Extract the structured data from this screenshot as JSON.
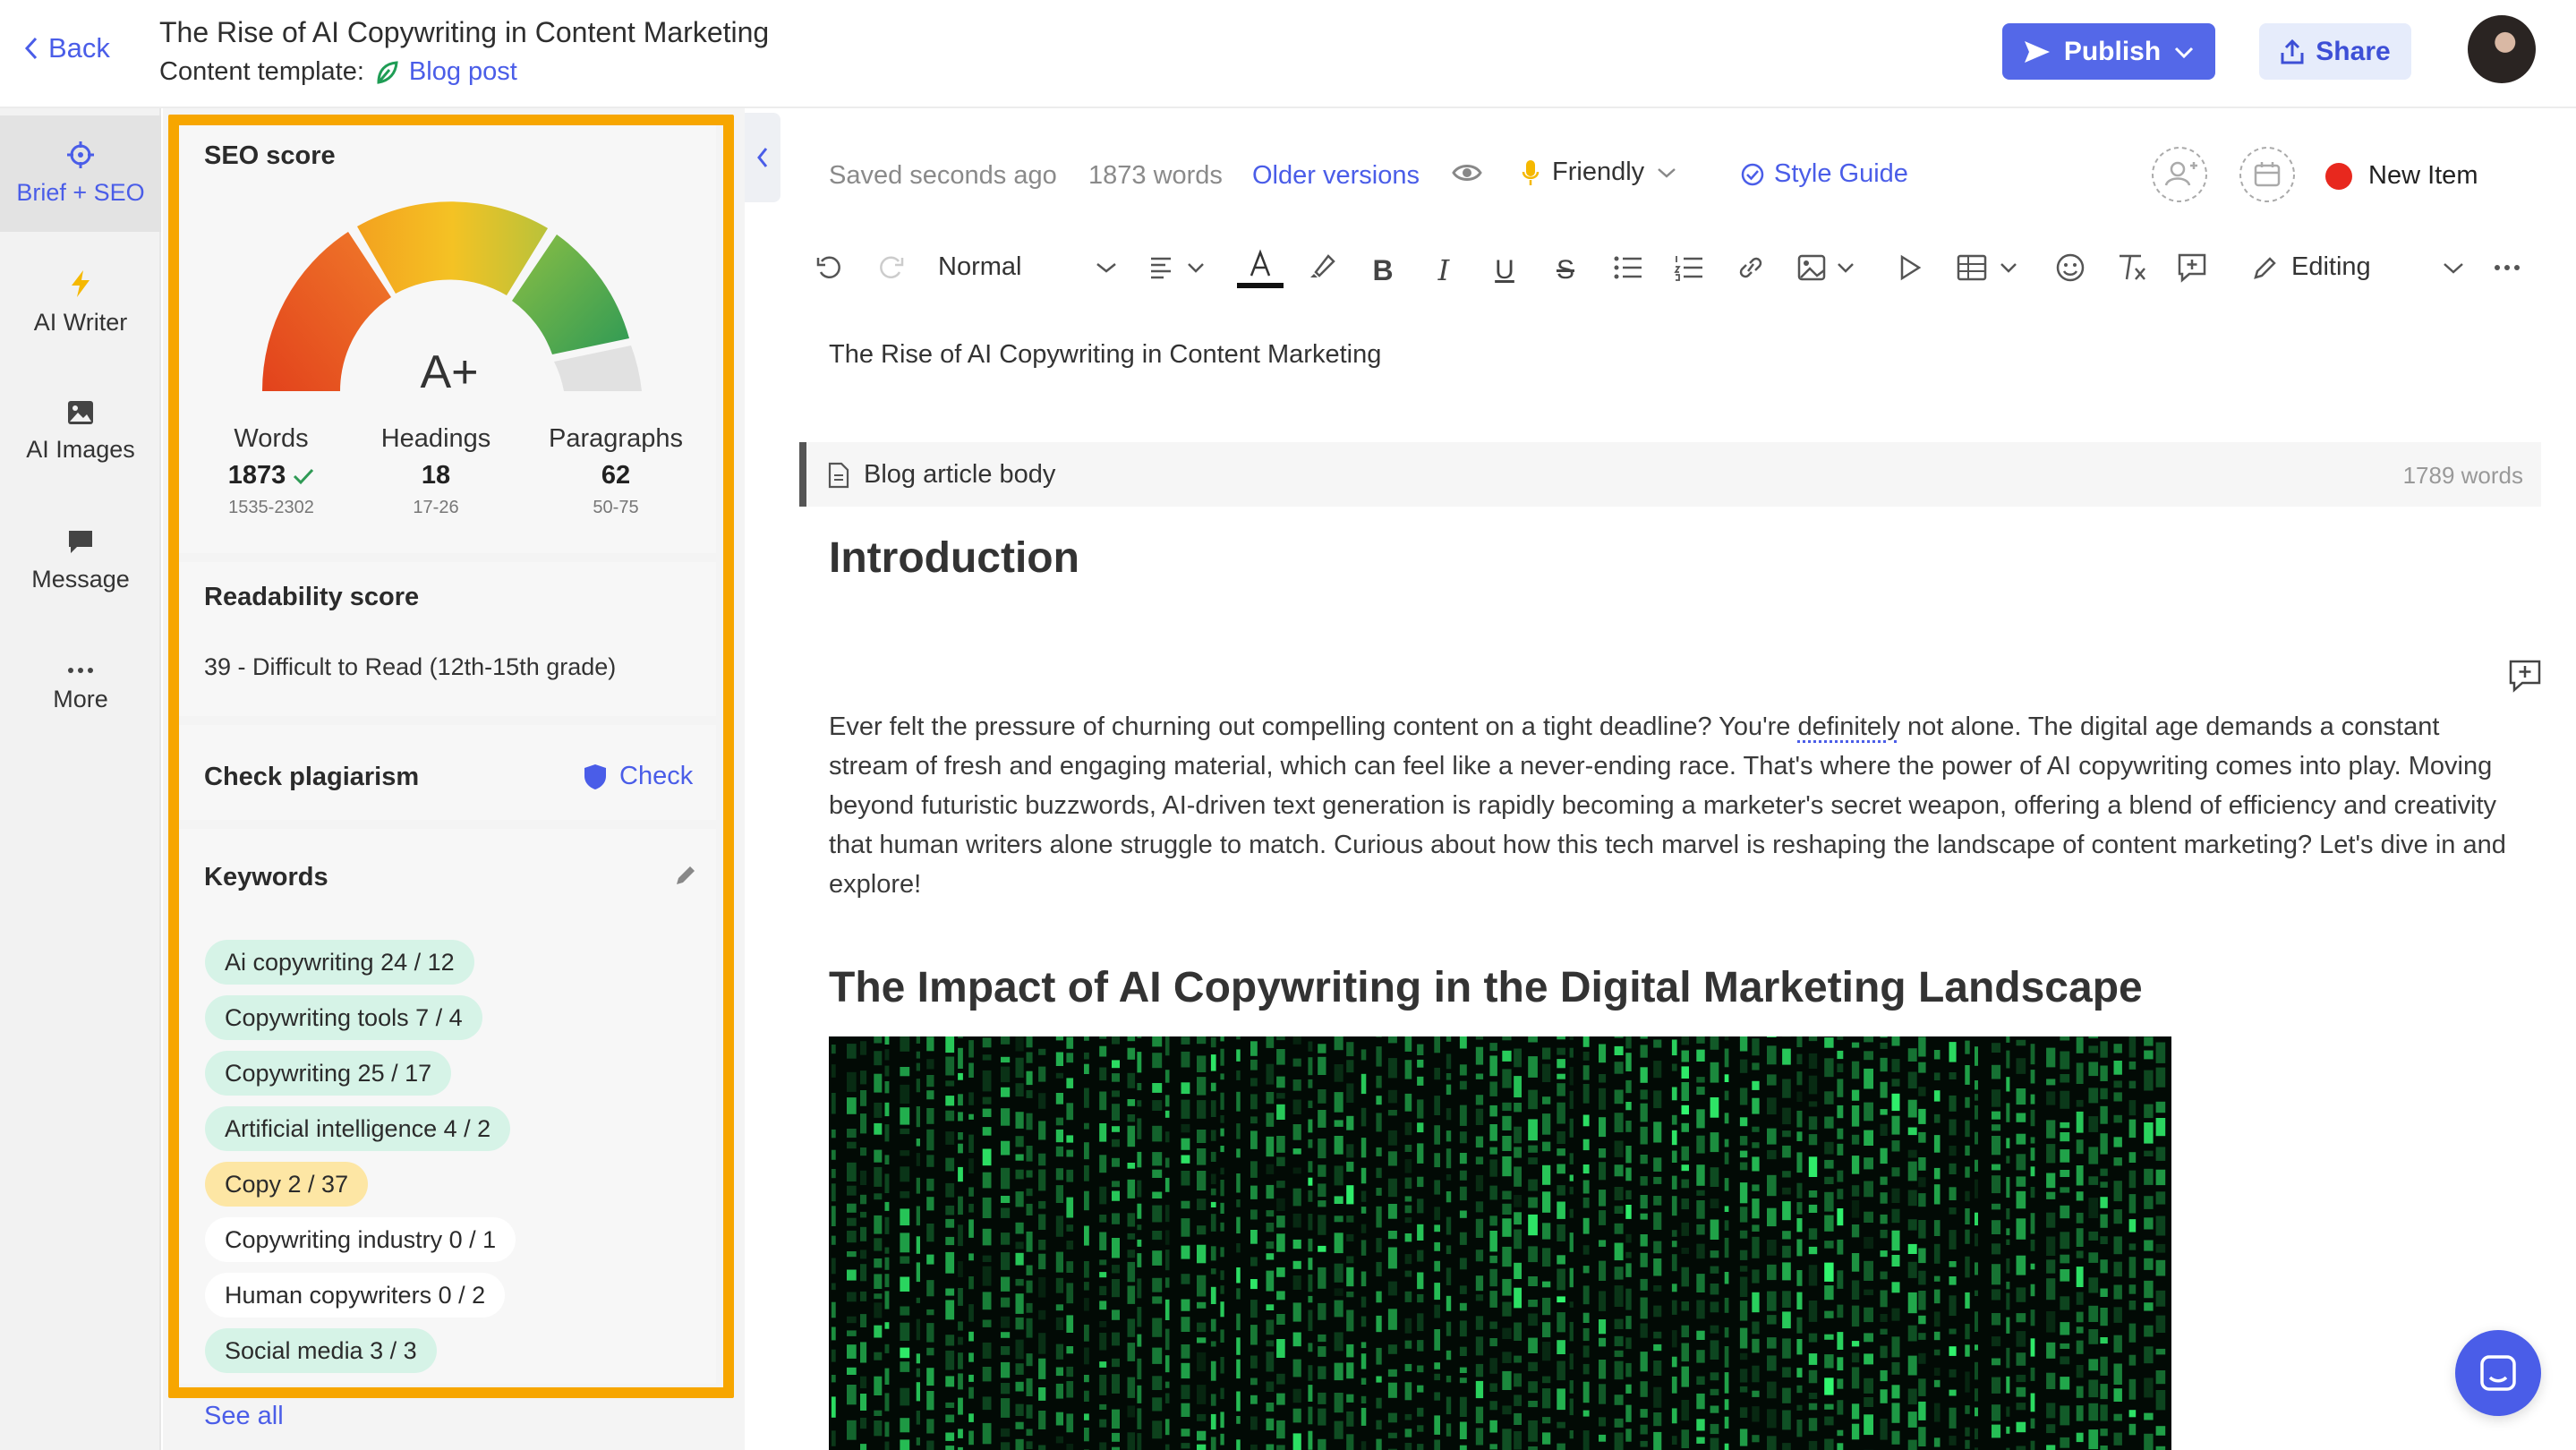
{
  "header": {
    "back_label": "Back",
    "title": "The Rise of AI Copywriting in Content Marketing",
    "template_label": "Content template:",
    "template_value": "Blog post",
    "publish_label": "Publish",
    "share_label": "Share"
  },
  "rail": {
    "items": [
      {
        "label": "Brief + SEO",
        "icon": "crosshair-icon"
      },
      {
        "label": "AI Writer",
        "icon": "lightning-icon"
      },
      {
        "label": "AI Images",
        "icon": "image-icon"
      },
      {
        "label": "Message",
        "icon": "chat-bubble-icon"
      },
      {
        "label": "More",
        "icon": "ellipsis-icon"
      }
    ]
  },
  "seo": {
    "title": "SEO score",
    "grade": "A+",
    "metrics": [
      {
        "label": "Words",
        "value": "1873",
        "range": "1535-2302"
      },
      {
        "label": "Headings",
        "value": "18",
        "range": "17-26"
      },
      {
        "label": "Paragraphs",
        "value": "62",
        "range": "50-75"
      }
    ],
    "readability_title": "Readability score",
    "readability_value": "39 - Difficult to Read (12th-15th grade)",
    "plagiarism_title": "Check plagiarism",
    "plagiarism_action": "Check",
    "keywords_title": "Keywords",
    "keywords": [
      {
        "text": "Ai copywriting  24 / 12",
        "status": "green"
      },
      {
        "text": "Copywriting tools  7 / 4",
        "status": "green"
      },
      {
        "text": "Copywriting  25 / 17",
        "status": "green"
      },
      {
        "text": "Artificial intelligence  4 / 2",
        "status": "green"
      },
      {
        "text": "Copy  2 / 37",
        "status": "orange"
      },
      {
        "text": "Copywriting industry  0 / 1",
        "status": "white"
      },
      {
        "text": "Human copywriters  0 / 2",
        "status": "white"
      },
      {
        "text": "Social media  3 / 3",
        "status": "green"
      }
    ],
    "see_all": "See all"
  },
  "status": {
    "saved": "Saved seconds ago",
    "words": "1873 words",
    "older_versions": "Older versions",
    "tone": "Friendly",
    "style_guide": "Style Guide",
    "new_item": "New Item"
  },
  "toolbar": {
    "block_style": "Normal",
    "mode": "Editing"
  },
  "editor": {
    "title": "The Rise of AI Copywriting in Content Marketing",
    "body_label": "Blog article body",
    "body_words": "1789 words",
    "h_intro": "Introduction",
    "intro_before": "Ever felt the pressure of churning out compelling content on a tight deadline? You're ",
    "intro_underlined": "definitely",
    "intro_after": " not alone. The digital age demands a constant stream of fresh and engaging material, which can feel like a never-ending race. That's where the power of AI copywriting comes into play. Moving beyond futuristic buzzwords, AI-driven text generation is rapidly becoming a marketer's secret weapon, offering a blend of efficiency and creativity that human writers alone struggle to match. Curious about how this tech marvel is reshaping the landscape of content marketing? Let's dive in and explore!",
    "h_impact": "The Impact of AI Copywriting in the Digital Marketing Landscape"
  },
  "colors": {
    "accent": "#5468e8",
    "highlight": "#f7a600",
    "keyword_green": "#d6f3e7",
    "keyword_orange": "#fde6a4",
    "recording_dot": "#e8281e"
  }
}
